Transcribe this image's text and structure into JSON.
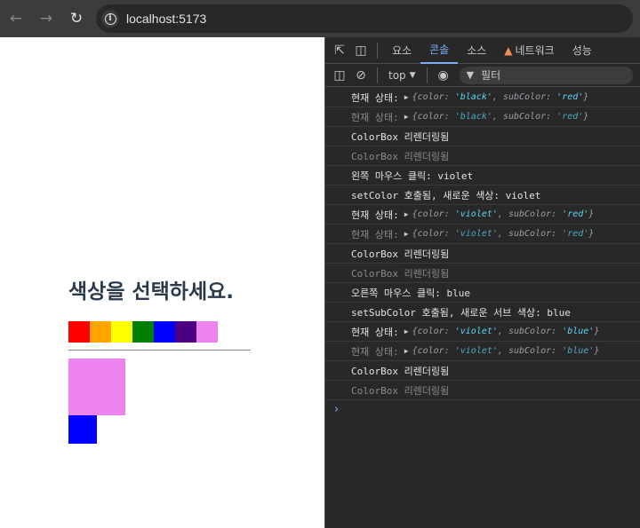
{
  "browser": {
    "url": "localhost:5173"
  },
  "page": {
    "heading": "색상을 선택하세요.",
    "palette": [
      "red",
      "orange",
      "yellow",
      "green",
      "blue",
      "indigo",
      "violet"
    ],
    "selected_color": "violet",
    "selected_sub_color": "blue"
  },
  "devtools": {
    "tabs": [
      "요소",
      "콘솔",
      "소스",
      "네트워크",
      "성능"
    ],
    "active_tab": "콘솔",
    "context": "top",
    "filter_placeholder": "필터",
    "logs": [
      {
        "text": "현재 상태: ",
        "color": "black",
        "subColor": "red",
        "dim": false
      },
      {
        "text": "현재 상태: ",
        "color": "black",
        "subColor": "red",
        "dim": true
      },
      {
        "text": "ColorBox 리렌더링됨",
        "dim": false
      },
      {
        "text": "ColorBox 리렌더링됨",
        "dim": true
      },
      {
        "text": "왼쪽 마우스 클릭: violet",
        "dim": false
      },
      {
        "text": "setColor 호출됨, 새로운 색상: violet",
        "dim": false
      },
      {
        "text": "현재 상태: ",
        "color": "violet",
        "subColor": "red",
        "dim": false
      },
      {
        "text": "현재 상태: ",
        "color": "violet",
        "subColor": "red",
        "dim": true
      },
      {
        "text": "ColorBox 리렌더링됨",
        "dim": false
      },
      {
        "text": "ColorBox 리렌더링됨",
        "dim": true
      },
      {
        "text": "오른쪽 마우스 클릭: blue",
        "dim": false
      },
      {
        "text": "setSubColor 호출됨, 새로운 서브 색상: blue",
        "dim": false
      },
      {
        "text": "현재 상태: ",
        "color": "violet",
        "subColor": "blue",
        "dim": false
      },
      {
        "text": "현재 상태: ",
        "color": "violet",
        "subColor": "blue",
        "dim": true
      },
      {
        "text": "ColorBox 리렌더링됨",
        "dim": false
      },
      {
        "text": "ColorBox 리렌더링됨",
        "dim": true
      }
    ]
  }
}
